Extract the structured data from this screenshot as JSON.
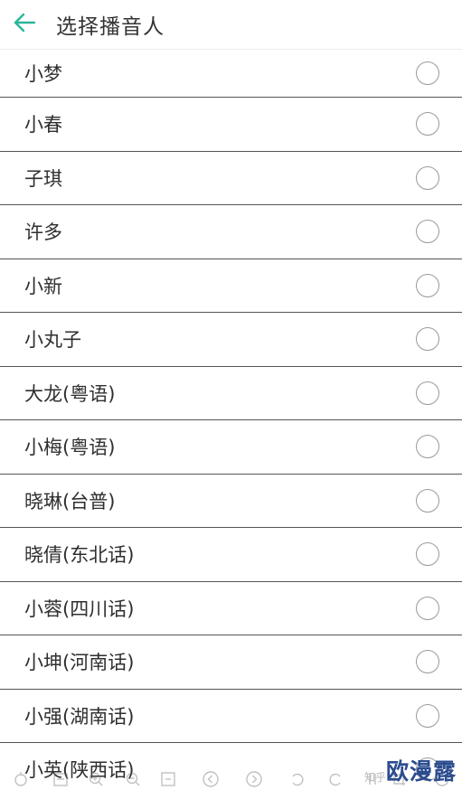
{
  "header": {
    "title": "选择播音人",
    "accent_color": "#2bb59a",
    "back_icon": "back-arrow-icon"
  },
  "speakers": [
    {
      "label": "小梦",
      "selected": false
    },
    {
      "label": "小春",
      "selected": false
    },
    {
      "label": "子琪",
      "selected": false
    },
    {
      "label": "许多",
      "selected": false
    },
    {
      "label": "小新",
      "selected": false
    },
    {
      "label": "小丸子",
      "selected": false
    },
    {
      "label": "大龙(粤语)",
      "selected": false
    },
    {
      "label": "小梅(粤语)",
      "selected": false
    },
    {
      "label": "晓琳(台普)",
      "selected": false
    },
    {
      "label": "晓倩(东北话)",
      "selected": false
    },
    {
      "label": "小蓉(四川话)",
      "selected": false
    },
    {
      "label": "小坤(河南话)",
      "selected": false
    },
    {
      "label": "小强(湖南话)",
      "selected": false
    },
    {
      "label": "小英(陕西话)",
      "selected": false
    }
  ],
  "viewer_toolbar": {
    "icons": [
      "rotate-icon",
      "minus-icon",
      "zoom-in-icon",
      "zoom-out-icon",
      "fit-icon",
      "prev-icon",
      "next-icon",
      "undo-icon",
      "redo-icon",
      "pause-icon",
      "crop-icon",
      "refresh-icon"
    ]
  },
  "watermark": {
    "site": "知乎",
    "brand": "欧漫露"
  }
}
